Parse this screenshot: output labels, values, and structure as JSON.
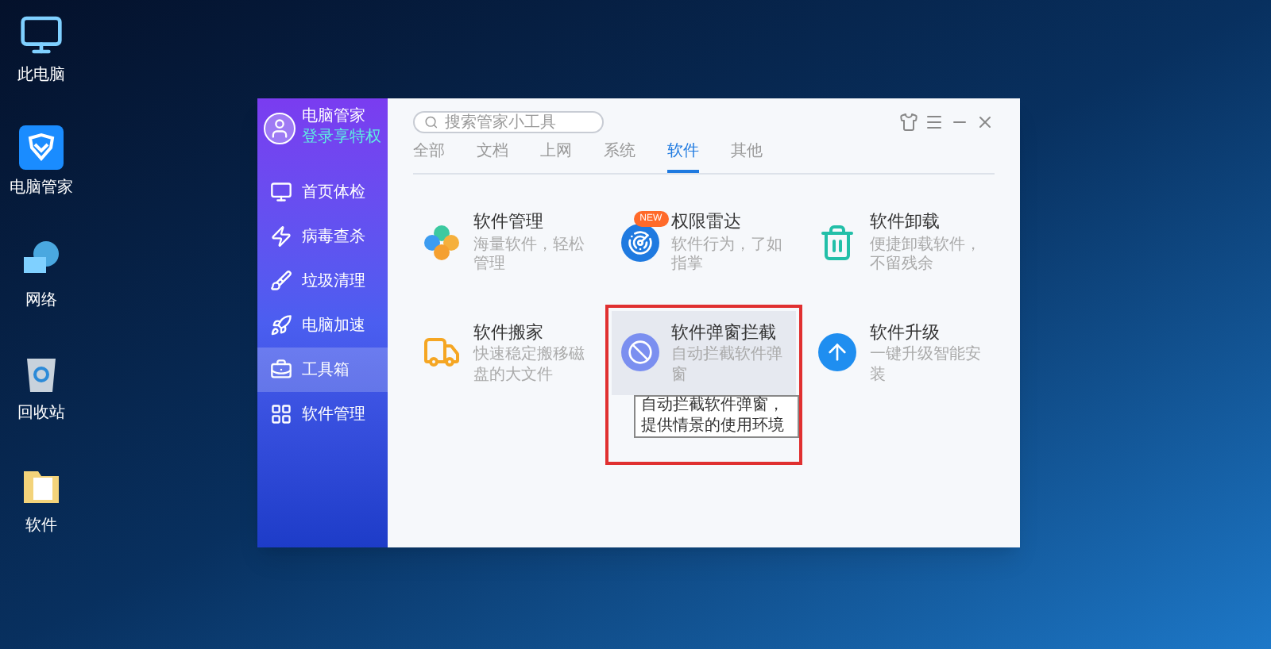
{
  "desktop_icons": [
    {
      "label": "此电脑",
      "kind": "computer"
    },
    {
      "label": "电脑管家",
      "kind": "shield"
    },
    {
      "label": "网络",
      "kind": "network"
    },
    {
      "label": "回收站",
      "kind": "bin"
    },
    {
      "label": "软件",
      "kind": "folder"
    }
  ],
  "window": {
    "user": {
      "name": "电脑管家",
      "link": "登录享特权"
    },
    "sidebar": {
      "items": [
        {
          "label": "首页体检",
          "kind": "monitor",
          "selected": false
        },
        {
          "label": "病毒查杀",
          "kind": "bolt",
          "selected": false
        },
        {
          "label": "垃圾清理",
          "kind": "broom",
          "selected": false
        },
        {
          "label": "电脑加速",
          "kind": "rocket",
          "selected": false
        },
        {
          "label": "工具箱",
          "kind": "toolbox",
          "selected": true
        },
        {
          "label": "软件管理",
          "kind": "apps",
          "selected": false
        }
      ]
    },
    "search": {
      "placeholder": "搜索管家小工具"
    },
    "tabs": [
      {
        "label": "全部",
        "selected": false
      },
      {
        "label": "文档",
        "selected": false
      },
      {
        "label": "上网",
        "selected": false
      },
      {
        "label": "系统",
        "selected": false
      },
      {
        "label": "软件",
        "selected": true
      },
      {
        "label": "其他",
        "selected": false
      }
    ],
    "tools": [
      {
        "title": "软件管理",
        "subtitle": "海量软件，轻松管理",
        "kind": "clover",
        "hovered": false
      },
      {
        "title": "权限雷达",
        "subtitle": "软件行为，了如指掌",
        "kind": "radar",
        "badge": "NEW",
        "hovered": false
      },
      {
        "title": "软件卸载",
        "subtitle": "便捷卸载软件，不留残余",
        "kind": "trash",
        "hovered": false
      },
      {
        "title": "软件搬家",
        "subtitle": "快速稳定搬移磁盘的大文件",
        "kind": "truck",
        "hovered": false
      },
      {
        "title": "软件弹窗拦截",
        "subtitle": "自动拦截软件弹窗",
        "kind": "block",
        "hovered": true,
        "tooltip": "自动拦截软件弹窗，提供情景的使用环境"
      },
      {
        "title": "软件升级",
        "subtitle": "一键升级智能安装",
        "kind": "upgrade",
        "hovered": false
      }
    ]
  }
}
